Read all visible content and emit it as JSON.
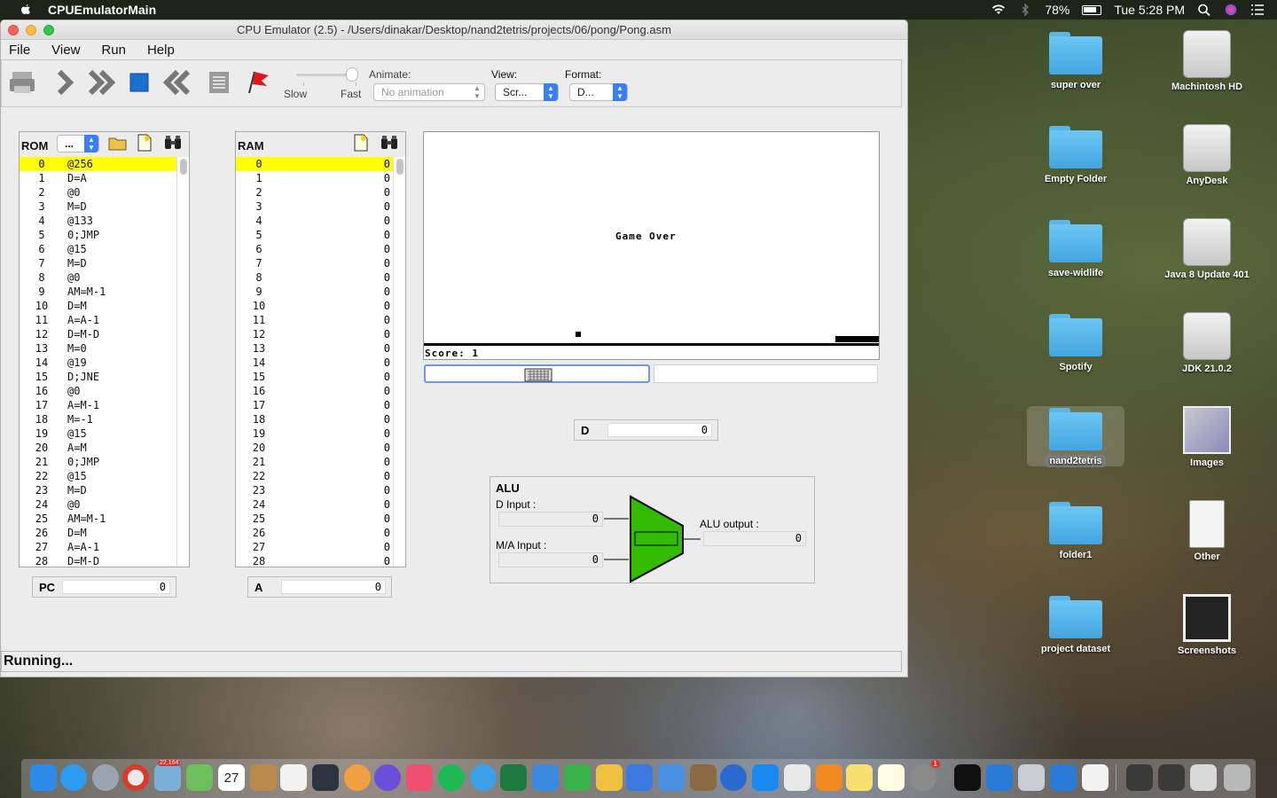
{
  "menubar": {
    "app_name": "CPUEmulatorMain",
    "battery": "78%",
    "clock": "Tue 5:28 PM"
  },
  "window": {
    "title": "CPU Emulator (2.5) - /Users/dinakar/Desktop/nand2tetris/projects/06/pong/Pong.asm",
    "menu": [
      "File",
      "View",
      "Run",
      "Help"
    ]
  },
  "toolbar": {
    "slow_label": "Slow",
    "fast_label": "Fast",
    "animate_label": "Animate:",
    "animate_value": "No animation",
    "view_label": "View:",
    "view_value": "Scr...",
    "format_label": "Format:",
    "format_value": "D..."
  },
  "rom": {
    "title": "ROM",
    "format_value": "...",
    "rows": [
      [
        "0",
        "@256"
      ],
      [
        "1",
        "D=A"
      ],
      [
        "2",
        "@0"
      ],
      [
        "3",
        "M=D"
      ],
      [
        "4",
        "@133"
      ],
      [
        "5",
        "0;JMP"
      ],
      [
        "6",
        "@15"
      ],
      [
        "7",
        "M=D"
      ],
      [
        "8",
        "@0"
      ],
      [
        "9",
        "AM=M-1"
      ],
      [
        "10",
        "D=M"
      ],
      [
        "11",
        "A=A-1"
      ],
      [
        "12",
        "D=M-D"
      ],
      [
        "13",
        "M=0"
      ],
      [
        "14",
        "@19"
      ],
      [
        "15",
        "D;JNE"
      ],
      [
        "16",
        "@0"
      ],
      [
        "17",
        "A=M-1"
      ],
      [
        "18",
        "M=-1"
      ],
      [
        "19",
        "@15"
      ],
      [
        "20",
        "A=M"
      ],
      [
        "21",
        "0;JMP"
      ],
      [
        "22",
        "@15"
      ],
      [
        "23",
        "M=D"
      ],
      [
        "24",
        "@0"
      ],
      [
        "25",
        "AM=M-1"
      ],
      [
        "26",
        "D=M"
      ],
      [
        "27",
        "A=A-1"
      ],
      [
        "28",
        "D=M-D"
      ]
    ]
  },
  "ram": {
    "title": "RAM",
    "rows": [
      [
        "0",
        "0"
      ],
      [
        "1",
        "0"
      ],
      [
        "2",
        "0"
      ],
      [
        "3",
        "0"
      ],
      [
        "4",
        "0"
      ],
      [
        "5",
        "0"
      ],
      [
        "6",
        "0"
      ],
      [
        "7",
        "0"
      ],
      [
        "8",
        "0"
      ],
      [
        "9",
        "0"
      ],
      [
        "10",
        "0"
      ],
      [
        "11",
        "0"
      ],
      [
        "12",
        "0"
      ],
      [
        "13",
        "0"
      ],
      [
        "14",
        "0"
      ],
      [
        "15",
        "0"
      ],
      [
        "16",
        "0"
      ],
      [
        "17",
        "0"
      ],
      [
        "18",
        "0"
      ],
      [
        "19",
        "0"
      ],
      [
        "20",
        "0"
      ],
      [
        "21",
        "0"
      ],
      [
        "22",
        "0"
      ],
      [
        "23",
        "0"
      ],
      [
        "24",
        "0"
      ],
      [
        "25",
        "0"
      ],
      [
        "26",
        "0"
      ],
      [
        "27",
        "0"
      ],
      [
        "28",
        "0"
      ]
    ]
  },
  "registers": {
    "pc_label": "PC",
    "pc_value": "0",
    "a_label": "A",
    "a_value": "0",
    "d_label": "D",
    "d_value": "0"
  },
  "screen": {
    "game_over": "Game Over",
    "score": "Score: 1"
  },
  "alu": {
    "title": "ALU",
    "d_input_label": "D Input :",
    "d_input_value": "0",
    "ma_input_label": "M/A Input :",
    "ma_input_value": "0",
    "output_label": "ALU output :",
    "output_value": "0",
    "color": "#33bb00"
  },
  "status": "Running...",
  "desktop_icons": [
    {
      "label": "super over",
      "icon": "folder-icon"
    },
    {
      "label": "Machintosh HD",
      "icon": "hard-drive-icon"
    },
    {
      "label": "Empty Folder",
      "icon": "folder-icon"
    },
    {
      "label": "AnyDesk",
      "icon": "disk-icon"
    },
    {
      "label": "save-widlife",
      "icon": "folder-icon"
    },
    {
      "label": "Java 8 Update 401",
      "icon": "disk-icon"
    },
    {
      "label": "Spotify",
      "icon": "folder-icon"
    },
    {
      "label": "JDK 21.0.2",
      "icon": "disk-icon"
    },
    {
      "label": "nand2tetris",
      "icon": "folder-icon"
    },
    {
      "label": "Images",
      "icon": "image-icon"
    },
    {
      "label": "folder1",
      "icon": "folder-icon"
    },
    {
      "label": "Other",
      "icon": "zip-icon"
    },
    {
      "label": "project dataset",
      "icon": "folder-icon"
    },
    {
      "label": "Screenshots",
      "icon": "screenshot-icon"
    }
  ],
  "dock": {
    "mail_badge": "22,164",
    "calendar_day": "27",
    "sysprefs_badge": "1"
  }
}
